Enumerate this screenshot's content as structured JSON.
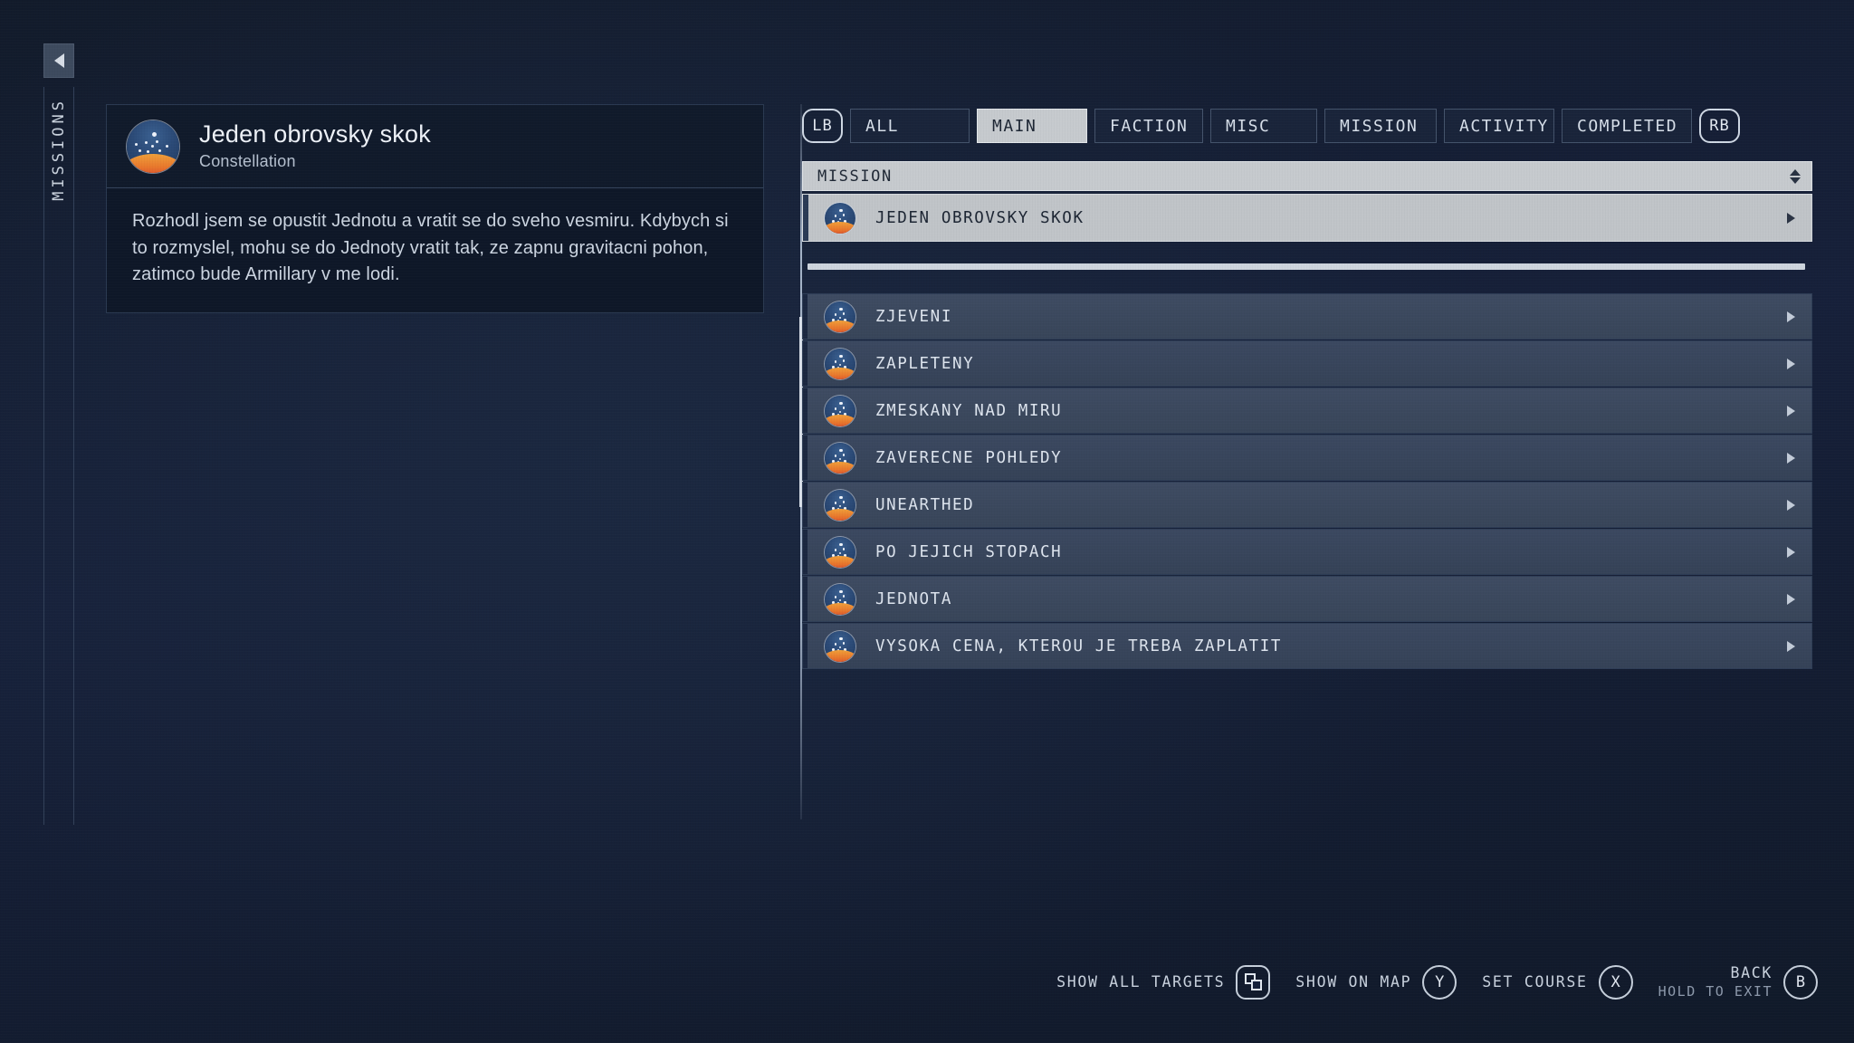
{
  "sidebar": {
    "back_icon": "chevron-left-icon",
    "label": "MISSIONS"
  },
  "detail": {
    "title": "Jeden obrovsky skok",
    "faction": "Constellation",
    "emblem": "constellation-emblem",
    "description": "Rozhodl jsem se opustit Jednotu a vratit se do sveho vesmiru. Kdybych si to rozmyslel, mohu se do Jednoty vratit tak, ze zapnu gravitacni pohon, zatimco bude Armillary v me lodi."
  },
  "tabs": {
    "left_bumper": "LB",
    "right_bumper": "RB",
    "items": [
      {
        "label": "ALL",
        "active": false
      },
      {
        "label": "MAIN",
        "active": true
      },
      {
        "label": "FACTION",
        "active": false
      },
      {
        "label": "MISC",
        "active": false
      },
      {
        "label": "MISSION",
        "active": false
      },
      {
        "label": "ACTIVITY",
        "active": false
      },
      {
        "label": "COMPLETED",
        "active": false
      }
    ]
  },
  "column_header": {
    "label": "MISSION",
    "sort_icon": "sort-updown-icon"
  },
  "tracked": {
    "label": "JEDEN OBROVSKY SKOK",
    "emblem": "constellation-emblem",
    "chevron": "chevron-right-icon"
  },
  "missions": [
    {
      "label": "ZJEVENI",
      "emblem": "constellation-emblem"
    },
    {
      "label": "ZAPLETENY",
      "emblem": "constellation-emblem"
    },
    {
      "label": "ZMESKANY NAD MIRU",
      "emblem": "constellation-emblem"
    },
    {
      "label": "ZAVERECNE POHLEDY",
      "emblem": "constellation-emblem"
    },
    {
      "label": "UNEARTHED",
      "emblem": "constellation-emblem"
    },
    {
      "label": "PO JEJICH STOPACH",
      "emblem": "constellation-emblem"
    },
    {
      "label": "JEDNOTA",
      "emblem": "constellation-emblem"
    },
    {
      "label": "VYSOKA CENA, KTEROU JE TREBA ZAPLATIT",
      "emblem": "constellation-emblem"
    }
  ],
  "actions": [
    {
      "label": "SHOW ALL TARGETS",
      "sub": "",
      "button": "view-icon"
    },
    {
      "label": "SHOW ON MAP",
      "sub": "",
      "button": "Y"
    },
    {
      "label": "SET COURSE",
      "sub": "",
      "button": "X"
    },
    {
      "label": "BACK",
      "sub": "HOLD TO EXIT",
      "button": "B"
    }
  ],
  "colors": {
    "background": "#131d2e",
    "accent_light": "#c6cace",
    "row": "#3b4860",
    "text": "#dde4ee",
    "emblem_sun": "#cf2f2f",
    "emblem_sky": "#2b4a77"
  }
}
